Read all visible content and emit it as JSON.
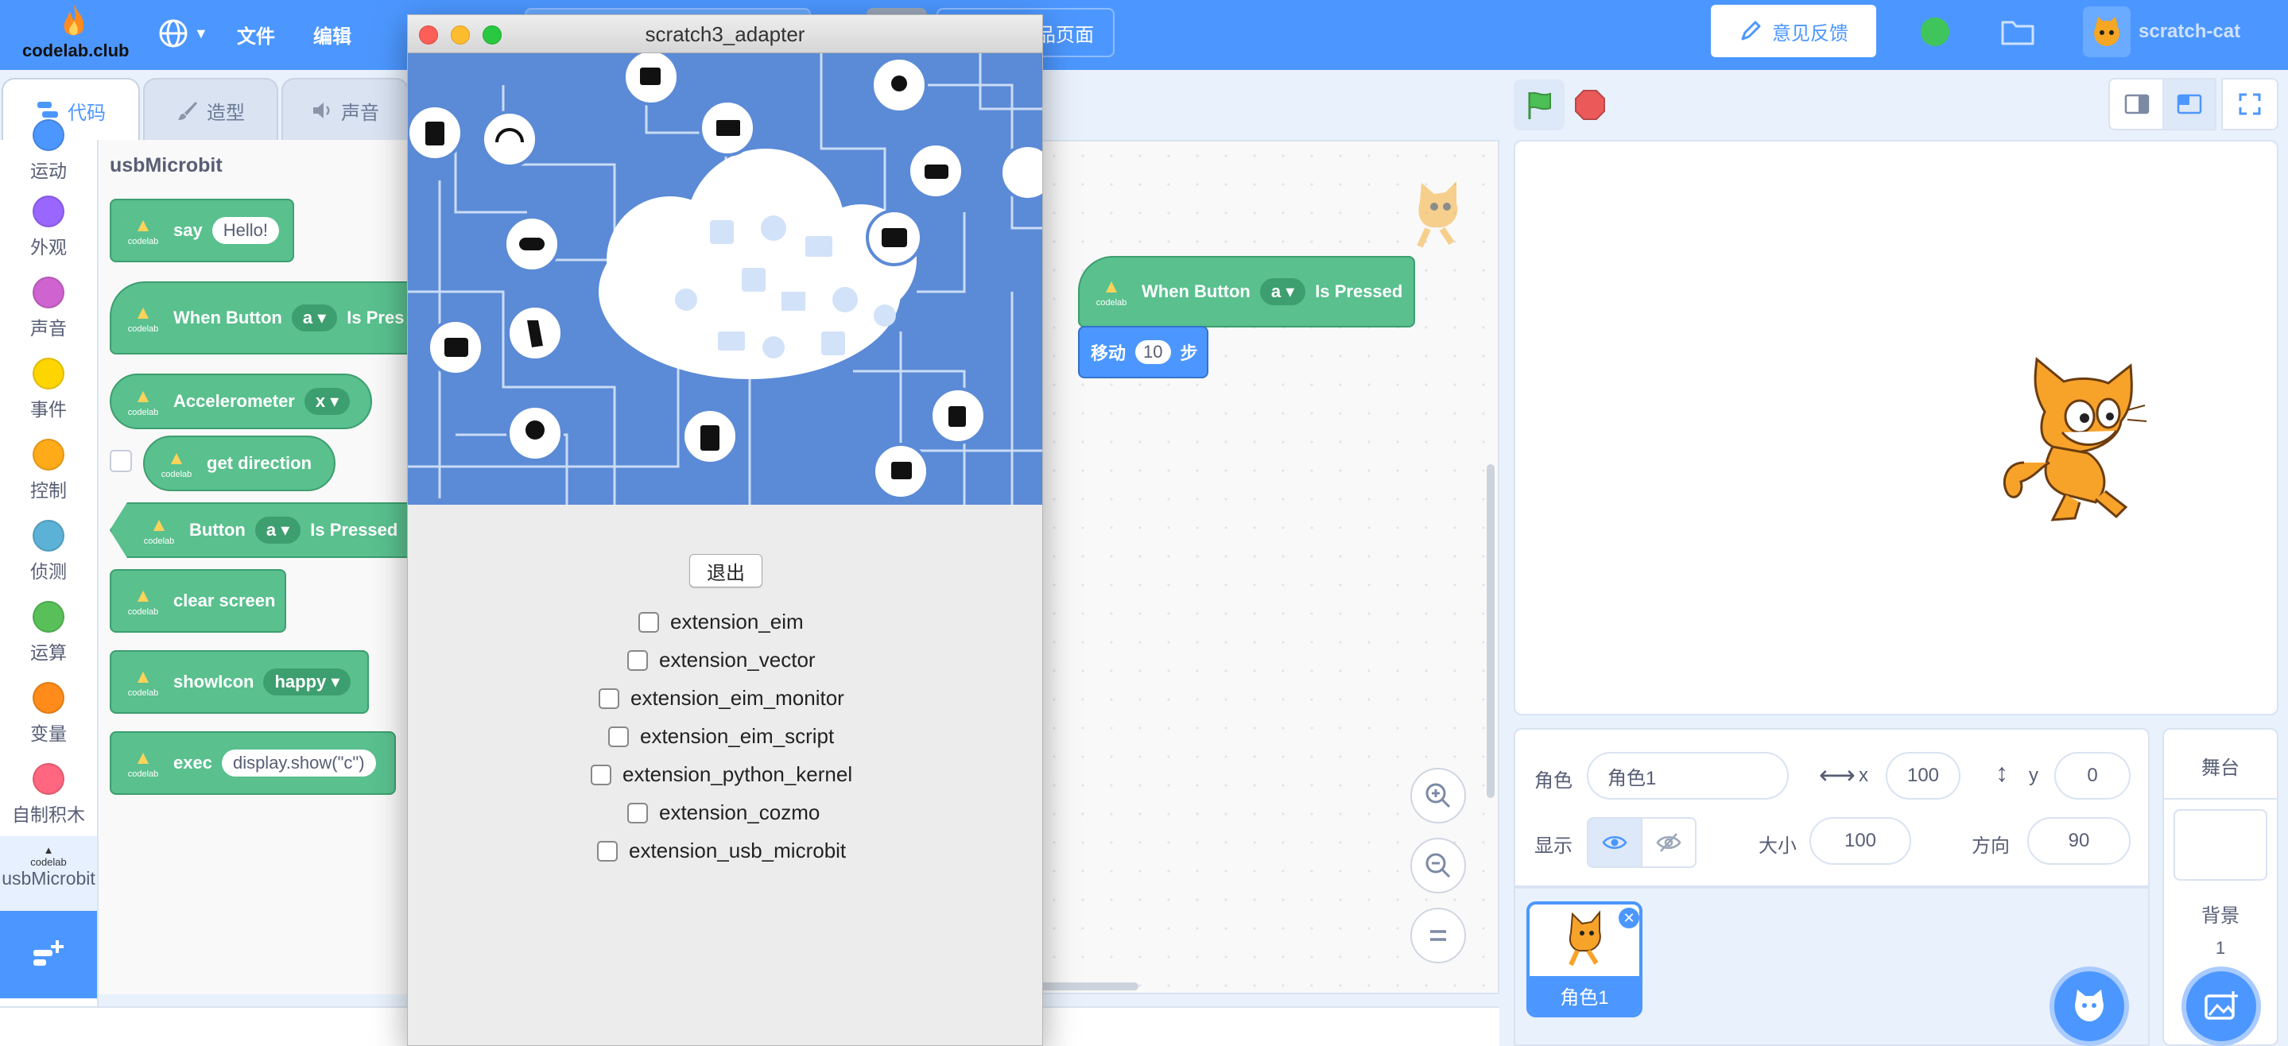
{
  "menubar": {
    "logo_text": "codelab.club",
    "file_label": "文件",
    "edit_label": "编辑",
    "hidden_tab_label": "品页面",
    "feedback_label": "意见反馈",
    "username": "scratch-cat"
  },
  "tabs": [
    {
      "label": "代码",
      "icon": "code-icon"
    },
    {
      "label": "造型",
      "icon": "brush-icon"
    },
    {
      "label": "声音",
      "icon": "speaker-icon"
    }
  ],
  "categories": [
    {
      "label": "运动",
      "color": "#4c97ff"
    },
    {
      "label": "外观",
      "color": "#9966ff"
    },
    {
      "label": "声音",
      "color": "#cf63cf"
    },
    {
      "label": "事件",
      "color": "#ffd500"
    },
    {
      "label": "控制",
      "color": "#ffab19"
    },
    {
      "label": "侦测",
      "color": "#5cb1d6"
    },
    {
      "label": "运算",
      "color": "#59c059"
    },
    {
      "label": "变量",
      "color": "#ff8c1a"
    },
    {
      "label": "自制积木",
      "color": "#ff6680"
    },
    {
      "label": "usbMicrobit",
      "color": "#59c08e"
    }
  ],
  "palette": {
    "heading": "usbMicrobit",
    "blocks": {
      "say": {
        "text": "say",
        "value": "Hello!"
      },
      "when_button": {
        "text": "When Button",
        "value": "a",
        "suffix": "Is Pres"
      },
      "accelerometer": {
        "text": "Accelerometer",
        "value": "x"
      },
      "get_direction": {
        "text": "get direction"
      },
      "button_pressed": {
        "text": "Button",
        "value": "a",
        "suffix": "Is Pressed"
      },
      "clear_screen": {
        "text": "clear screen"
      },
      "show_icon": {
        "text": "showIcon",
        "value": "happy"
      },
      "exec": {
        "text": "exec",
        "value": "display.show(\"c\")"
      }
    }
  },
  "script": {
    "hat": {
      "text": "When Button",
      "value": "a",
      "suffix": "Is Pressed"
    },
    "move": {
      "text": "移动",
      "value": "10",
      "suffix": "步"
    }
  },
  "sprite_info": {
    "sprite_label": "角色",
    "sprite_name": "角色1",
    "x_label": "x",
    "x_value": "100",
    "y_label": "y",
    "y_value": "0",
    "show_label": "显示",
    "size_label": "大小",
    "size_value": "100",
    "direction_label": "方向",
    "direction_value": "90"
  },
  "sprite_list": [
    {
      "name": "角色1"
    }
  ],
  "stage_panel": {
    "title": "舞台",
    "backdrop_label": "背景",
    "backdrop_count": "1"
  },
  "dialog": {
    "title": "scratch3_adapter",
    "exit_label": "退出",
    "extensions": [
      {
        "name": "extension_eim",
        "checked": false
      },
      {
        "name": "extension_vector",
        "checked": false
      },
      {
        "name": "extension_eim_monitor",
        "checked": false
      },
      {
        "name": "extension_eim_script",
        "checked": false
      },
      {
        "name": "extension_python_kernel",
        "checked": false
      },
      {
        "name": "extension_cozmo",
        "checked": false
      },
      {
        "name": "extension_usb_microbit",
        "checked": false
      }
    ]
  },
  "colors": {
    "menubar": "#4c97ff",
    "extension_block": "#59c08e",
    "motion_block": "#4c97ff",
    "green_flag": "#4cbf56",
    "stop": "#ec5959"
  }
}
